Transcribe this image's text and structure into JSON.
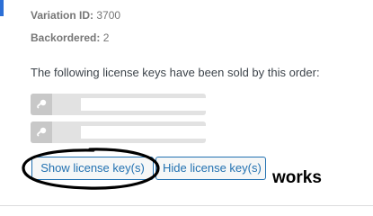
{
  "order_meta": {
    "variation_label": "Variation ID:",
    "variation_value": "3700",
    "backordered_label": "Backordered:",
    "backordered_value": "2"
  },
  "license_section": {
    "intro_text": "The following license keys have been sold by this order:",
    "keys": [
      {
        "icon": "key-icon",
        "value": ""
      },
      {
        "icon": "key-icon",
        "value": ""
      }
    ]
  },
  "actions": {
    "show_label": "Show license key(s)",
    "hide_label": "Hide license key(s)"
  },
  "annotation": {
    "note": "works"
  },
  "colors": {
    "button_accent": "#2271b1",
    "key_row_bg": "#e2e2e2",
    "annotation_ink": "#000000"
  }
}
